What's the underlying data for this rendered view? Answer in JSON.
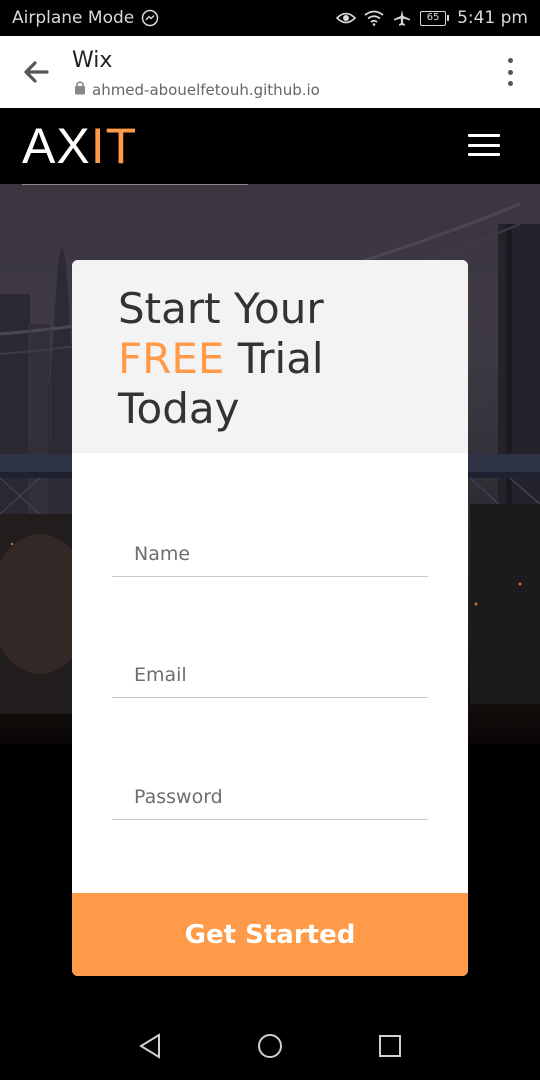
{
  "status_bar": {
    "mode_label": "Airplane Mode",
    "battery": "65",
    "time": "5:41 pm",
    "icons": [
      "messenger-icon",
      "eye-icon",
      "wifi-icon",
      "airplane-icon",
      "battery-icon"
    ]
  },
  "browser": {
    "title": "Wix",
    "url": "ahmed-abouelfetouh.github.io",
    "icons": [
      "back-arrow-icon",
      "lock-icon",
      "more-vert-icon"
    ]
  },
  "site": {
    "logo_part1": "AX",
    "logo_part2": "IT",
    "menu_icon": "hamburger-icon"
  },
  "signup": {
    "title_line1": "Start Your",
    "title_free": "FREE",
    "title_trial": " Trial",
    "title_line3": "Today",
    "name_placeholder": "Name",
    "email_placeholder": "Email",
    "password_placeholder": "Password",
    "submit_label": "Get Started"
  },
  "system_nav": {
    "icons": [
      "back-triangle-icon",
      "home-circle-icon",
      "recents-square-icon"
    ]
  },
  "colors": {
    "accent": "#ff9a48",
    "header_bg": "#000000",
    "card_header_bg": "#f3f3f3"
  }
}
